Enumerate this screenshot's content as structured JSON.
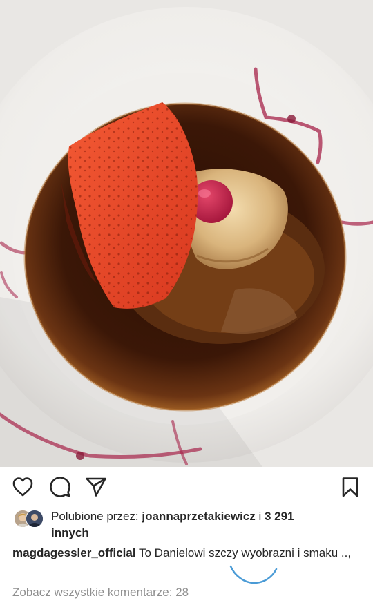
{
  "post": {
    "photo_alt": "",
    "actions": {
      "like_icon": "heart-outline-icon",
      "comment_icon": "comment-bubble-icon",
      "share_icon": "paper-plane-icon",
      "save_icon": "bookmark-outline-icon"
    },
    "likes": {
      "prefix": "Polubione przez: ",
      "user": "joannaprzetakiewicz",
      "connector": " i ",
      "count": "3 291",
      "suffix": "innych"
    },
    "caption": {
      "username": "magdagessler_official",
      "text": "To Danielowi szczy wyobrazni i smaku ..,"
    },
    "view_comments": "Zobacz wszystkie komentarze: 28"
  },
  "colors": {
    "text": "#262626",
    "muted": "#8e8e8e",
    "sauce": "#4a1f0b",
    "tuile": "#e8452a",
    "wine": "#9b1f3a",
    "smile": "#4a9bd6"
  }
}
